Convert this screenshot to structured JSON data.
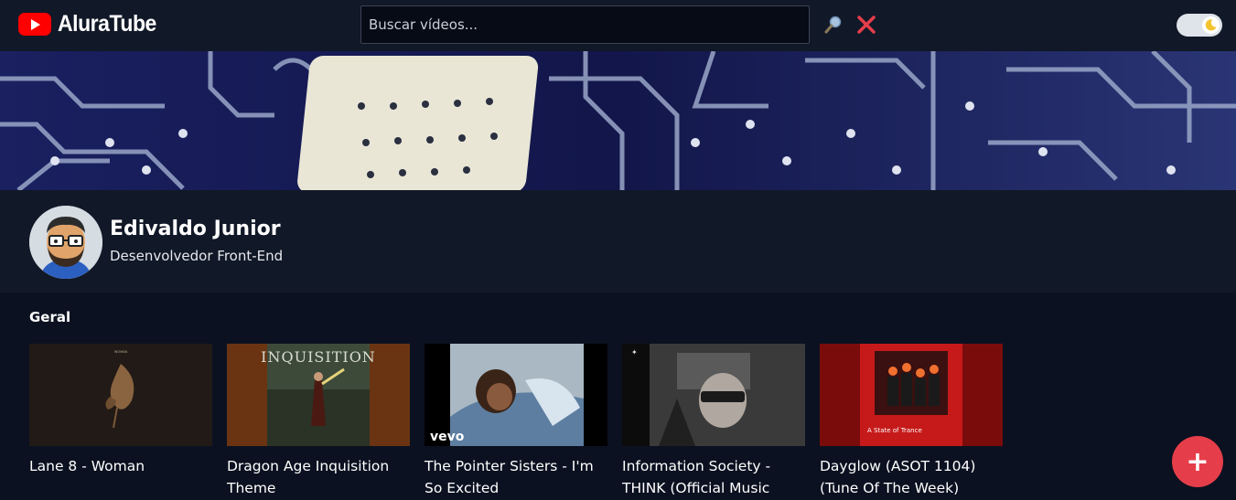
{
  "header": {
    "logo_text": "AluraTube",
    "search_placeholder": "Buscar vídeos..."
  },
  "profile": {
    "name": "Edivaldo Junior",
    "role": "Desenvolvedor Front-End"
  },
  "section": {
    "title": "Geral"
  },
  "videos": [
    {
      "title": "Lane 8 - Woman",
      "thumb_text": "WOMAN"
    },
    {
      "title": "Dragon Age Inquisition Theme",
      "thumb_text": "INQUISITION"
    },
    {
      "title": "The Pointer Sisters - I'm So Excited",
      "thumb_text": "vevo"
    },
    {
      "title": "Information Society - THINK (Official Music",
      "thumb_text": ""
    },
    {
      "title": "Dayglow (ASOT 1104) (Tune Of The Week)",
      "thumb_text": "A State of Trance"
    }
  ],
  "colors": {
    "header_bg": "#111827",
    "page_bg": "#0b1120",
    "accent_red": "#e53e4a",
    "youtube_red": "#ff0000"
  },
  "icons": {
    "search": "search-icon",
    "clear": "close-icon",
    "theme": "moon-icon",
    "add": "plus-icon"
  },
  "fab_label": "+"
}
